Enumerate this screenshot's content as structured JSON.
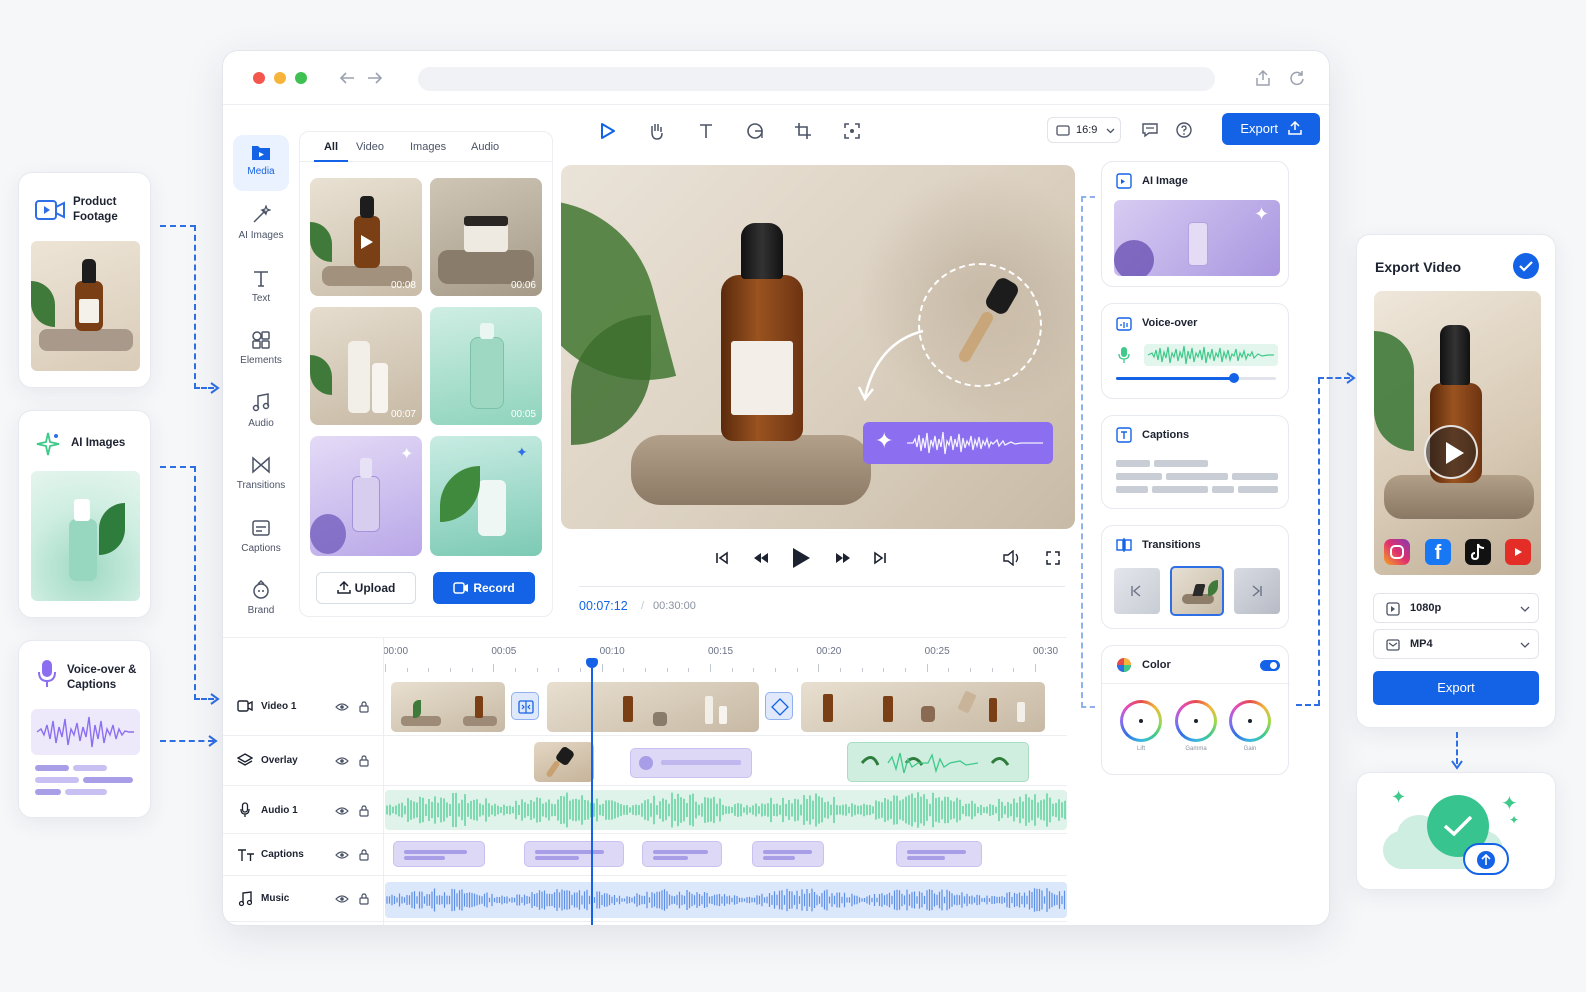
{
  "left_cards": {
    "product": {
      "title": "Product Footage"
    },
    "ai_images": {
      "title": "AI Images"
    },
    "voice": {
      "title": "Voice-over & Captions"
    }
  },
  "toolbar": {
    "aspect": "16:9",
    "export_label": "Export"
  },
  "sidebar": {
    "items": [
      {
        "label": "Media",
        "icon": "folder-icon"
      },
      {
        "label": "AI Images",
        "icon": "sparkle-brush-icon"
      },
      {
        "label": "Text",
        "icon": "text-icon"
      },
      {
        "label": "Elements",
        "icon": "shapes-icon"
      },
      {
        "label": "Audio",
        "icon": "music-icon"
      },
      {
        "label": "Transitions",
        "icon": "bowtie-icon"
      },
      {
        "label": "Captions",
        "icon": "caption-icon"
      },
      {
        "label": "Brand",
        "icon": "brand-icon"
      }
    ]
  },
  "media_panel": {
    "tabs": [
      "All",
      "Video",
      "Images",
      "Audio"
    ],
    "active_tab": "All",
    "thumbs": [
      {
        "duration": "00:08"
      },
      {
        "duration": "00:06"
      },
      {
        "duration": "00:07"
      },
      {
        "duration": "00:05"
      },
      {
        "duration": ""
      },
      {
        "duration": ""
      }
    ],
    "upload_label": "Upload",
    "record_label": "Record"
  },
  "player": {
    "current_time": "00:07:12",
    "separator": "/",
    "total_time": "00:30:00"
  },
  "right_panel": {
    "ai_image": "AI Image",
    "voice_over": "Voice-over",
    "voice_volume": 0.74,
    "captions": "Captions",
    "transitions": "Transitions",
    "color": "Color",
    "color_enabled": true,
    "wheels": [
      "Lift",
      "Gamma",
      "Gain"
    ]
  },
  "timeline": {
    "ticks": [
      "00:00",
      "00:05",
      "00:10",
      "00:15",
      "00:20",
      "00:25",
      "00:30"
    ],
    "tracks": [
      "Video 1",
      "Overlay",
      "Audio 1",
      "Captions",
      "Music"
    ],
    "playhead_seconds": 7.2
  },
  "export_card": {
    "title": "Export Video",
    "resolution": "1080p",
    "format": "MP4",
    "export_label": "Export",
    "social": [
      "instagram-icon",
      "facebook-icon",
      "tiktok-icon",
      "youtube-icon"
    ]
  },
  "colors": {
    "accent": "#1463e6",
    "purple": "#8b6ff0",
    "green": "#3fc98a"
  }
}
